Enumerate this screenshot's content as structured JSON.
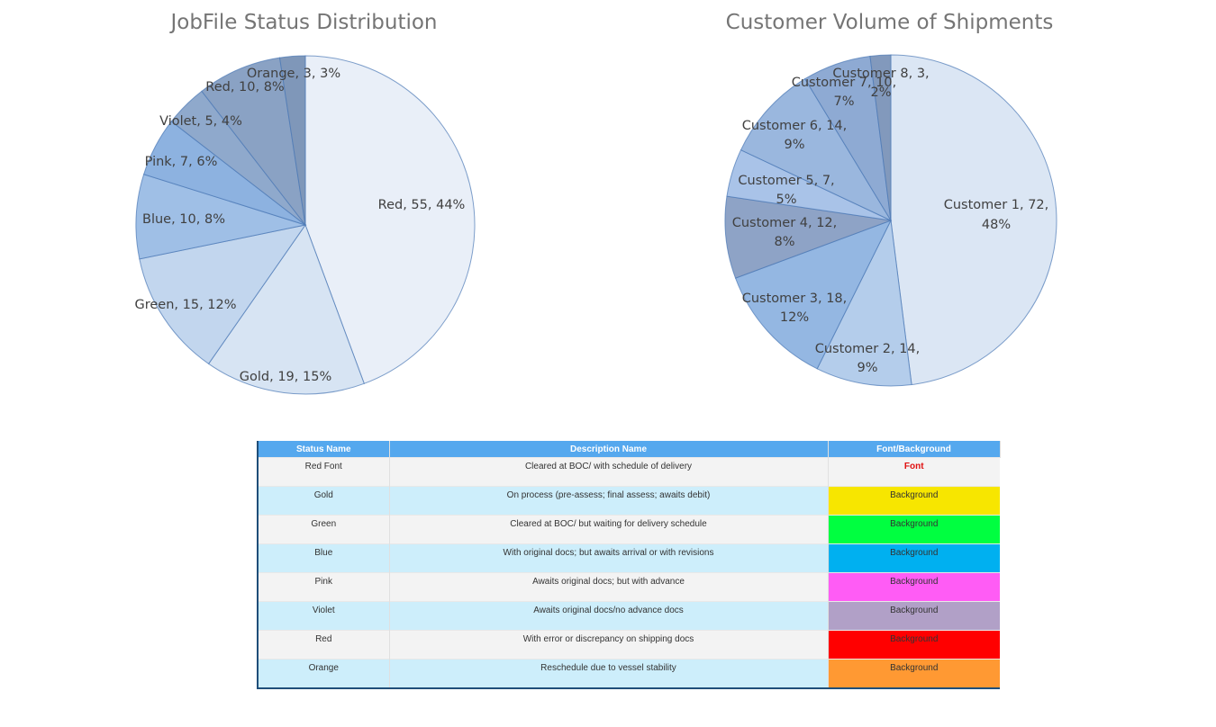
{
  "chart_data": [
    {
      "type": "pie",
      "title": "JobFile Status Distribution",
      "slices": [
        {
          "label": "Red, 55, 44%",
          "value": 55,
          "color": "#e9eff8"
        },
        {
          "label": "Gold, 19, 15%",
          "value": 19,
          "color": "#d7e4f3"
        },
        {
          "label": "Green, 15, 12%",
          "value": 15,
          "color": "#c2d6ee"
        },
        {
          "label": "Blue, 10, 8%",
          "value": 10,
          "color": "#9fbfe6"
        },
        {
          "label": "Pink, 7, 6%",
          "value": 7,
          "color": "#8db2e0"
        },
        {
          "label": "Violet, 5, 4%",
          "value": 5,
          "color": "#8fa9cc"
        },
        {
          "label": "Red, 10, 8%",
          "value": 10,
          "color": "#8aa2c4"
        },
        {
          "label": "Orange, 3, 3%",
          "value": 3,
          "color": "#7f97b9"
        }
      ]
    },
    {
      "type": "pie",
      "title": "Customer Volume of Shipments",
      "slices": [
        {
          "label": "Customer 1, 72, 48%",
          "value": 72,
          "color": "#dbe6f4"
        },
        {
          "label": "Customer 2, 14, 9%",
          "value": 14,
          "color": "#b4cdeb"
        },
        {
          "label": "Customer 3, 18, 12%",
          "value": 18,
          "color": "#94b7e2"
        },
        {
          "label": "Customer 4, 12, 8%",
          "value": 12,
          "color": "#8ea3c6"
        },
        {
          "label": "Customer 5, 7, 5%",
          "value": 7,
          "color": "#a9c3e8"
        },
        {
          "label": "Customer 6, 14, 9%",
          "value": 14,
          "color": "#9ab7de"
        },
        {
          "label": "Customer 7, 10, 7%",
          "value": 10,
          "color": "#8eaad3"
        },
        {
          "label": "Customer 8, 3, 2%",
          "value": 3,
          "color": "#8299bc"
        }
      ]
    }
  ],
  "legend_table": {
    "headers": [
      "Status Name",
      "Description Name",
      "Font/Background"
    ],
    "rows": [
      {
        "status": "Red Font",
        "description": "Cleared at BOC/ with schedule of delivery",
        "sample": "Font",
        "kind": "font",
        "color": "#e01010"
      },
      {
        "status": "Gold",
        "description": "On process (pre-assess; final assess; awaits debit)",
        "sample": "Background",
        "kind": "background",
        "color": "#f7e600"
      },
      {
        "status": "Green",
        "description": "Cleared at BOC/ but waiting for delivery schedule",
        "sample": "Background",
        "kind": "background",
        "color": "#00ff40"
      },
      {
        "status": "Blue",
        "description": "With original docs; but awaits arrival or with revisions",
        "sample": "Background",
        "kind": "background",
        "color": "#00b0f0"
      },
      {
        "status": "Pink",
        "description": "Awaits original docs; but with advance",
        "sample": "Background",
        "kind": "background",
        "color": "#ff5cf5"
      },
      {
        "status": "Violet",
        "description": "Awaits original docs/no advance docs",
        "sample": "Background",
        "kind": "background",
        "color": "#b1a0c7"
      },
      {
        "status": "Red",
        "description": "With error or discrepancy on shipping docs",
        "sample": "Background",
        "kind": "background",
        "color": "#ff0000"
      },
      {
        "status": "Orange",
        "description": "Reschedule due to vessel stability",
        "sample": "Background",
        "kind": "background",
        "color": "#ff9933"
      }
    ]
  }
}
